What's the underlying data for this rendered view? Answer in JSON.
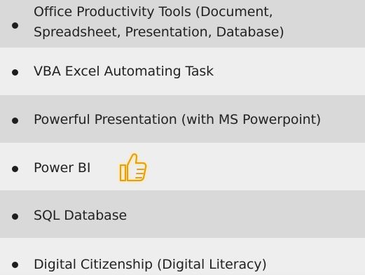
{
  "items": [
    {
      "line1": "Office Productivity Tools (Document,",
      "line2": "Spreadsheet, Presentation, Database)"
    },
    {
      "label": "VBA Excel Automating Task"
    },
    {
      "label": "Powerful Presentation (with MS Powerpoint)"
    },
    {
      "label": "Power BI",
      "icon": "thumbs-up-icon"
    },
    {
      "label": "SQL Database"
    },
    {
      "label": "Digital Citizenship (Digital Literacy)"
    }
  ],
  "colors": {
    "shaded_row": "#d9d9d9",
    "light_row": "#eeeeee",
    "text": "#222222",
    "icon_stroke": "#e2a016",
    "icon_glow": "#ffe9a8"
  }
}
